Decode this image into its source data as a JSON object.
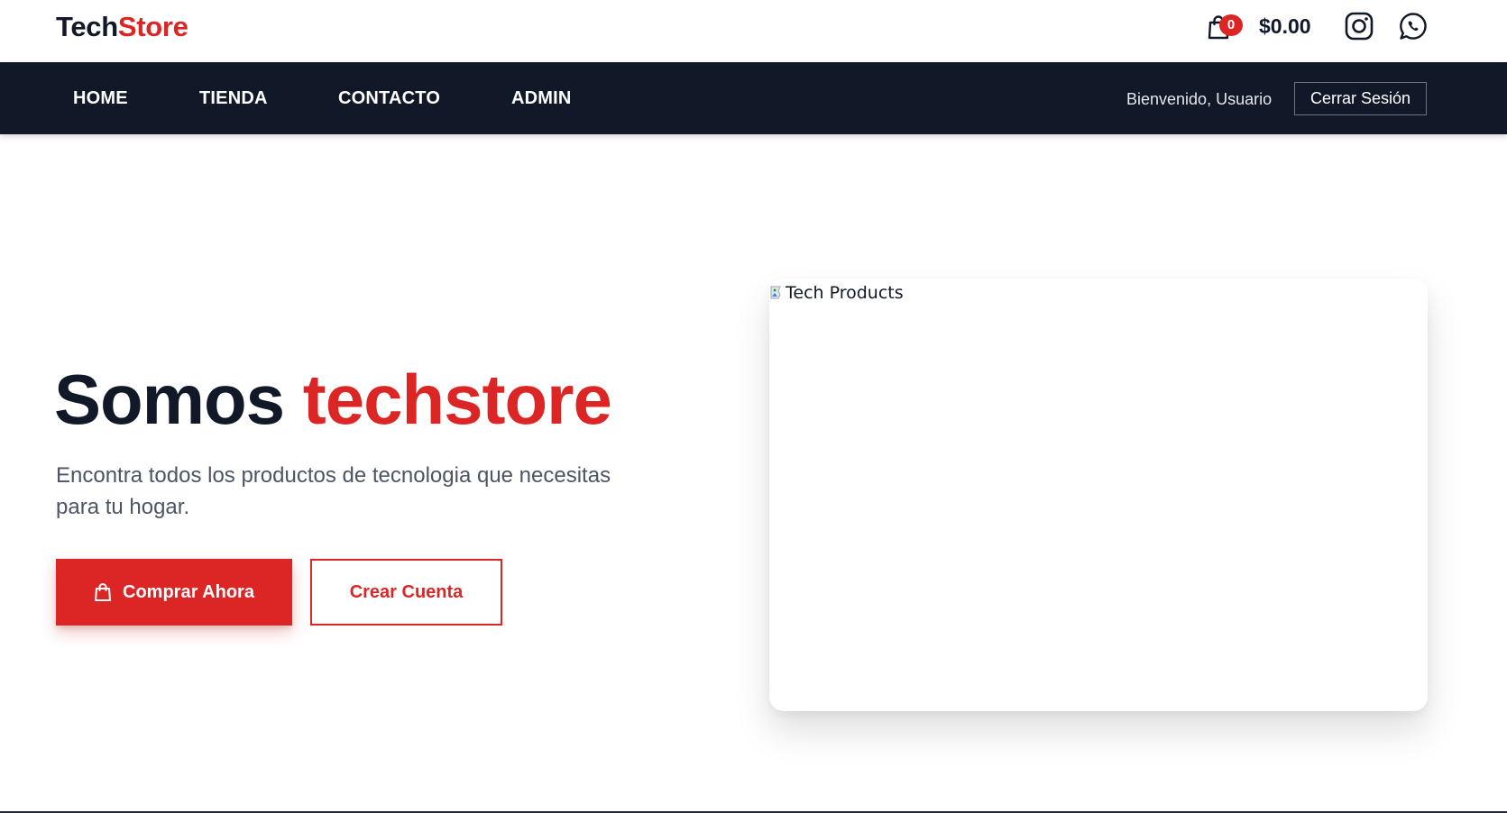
{
  "brand": {
    "part1": "Tech",
    "part2": "Store",
    "accent_color": "#dc2626",
    "dark_color": "#111827"
  },
  "header": {
    "cart_icon": "shopping-bag-icon",
    "cart_count": "0",
    "cart_total": "$0.00",
    "social": [
      "instagram-icon",
      "whatsapp-icon"
    ]
  },
  "nav": {
    "links": [
      "HOME",
      "TIENDA",
      "CONTACTO",
      "ADMIN"
    ],
    "welcome": "Bienvenido, Usuario",
    "logout": "Cerrar Sesión",
    "background": "#111827"
  },
  "hero": {
    "title_part1": "Somos",
    "title_part2": "techstore",
    "subtitle": "Encontra todos los productos de tecnologia que necesitas para tu hogar.",
    "primary_button": "Comprar Ahora",
    "primary_icon": "shopping-bag-icon",
    "secondary_button": "Crear Cuenta",
    "image_alt": "Tech Products"
  }
}
